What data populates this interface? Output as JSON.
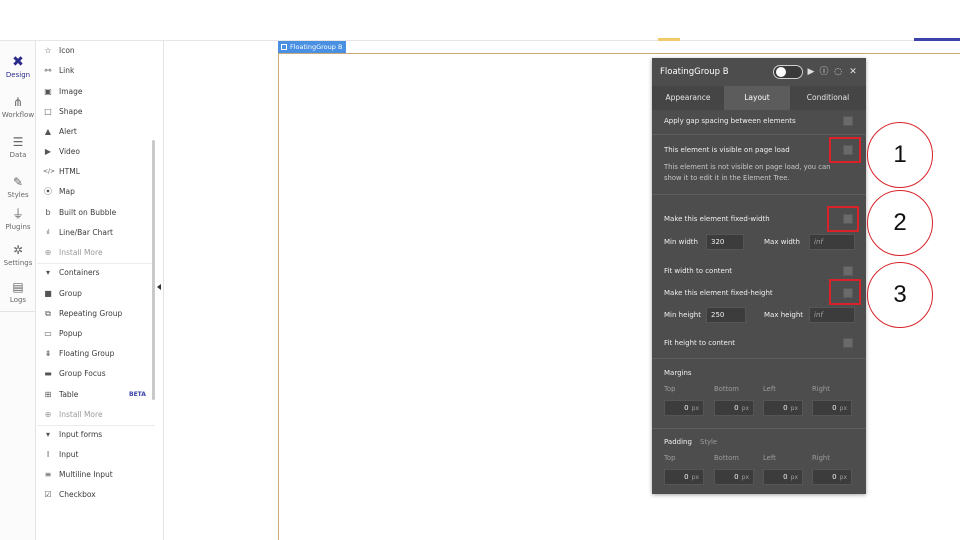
{
  "leftnav": {
    "items": [
      {
        "label": "Design",
        "icon": "design-icon"
      },
      {
        "label": "Workflow",
        "icon": "workflow-icon"
      },
      {
        "label": "Data",
        "icon": "data-icon"
      },
      {
        "label": "Styles",
        "icon": "styles-icon"
      },
      {
        "label": "Plugins",
        "icon": "plugins-icon"
      },
      {
        "label": "Settings",
        "icon": "settings-icon"
      },
      {
        "label": "Logs",
        "icon": "logs-icon"
      }
    ]
  },
  "palette": {
    "items": [
      {
        "label": "Icon",
        "icon": "star-icon",
        "glyph": "☆"
      },
      {
        "label": "Link",
        "icon": "link-icon",
        "glyph": "⚯"
      },
      {
        "label": "Image",
        "icon": "image-icon",
        "glyph": "▣"
      },
      {
        "label": "Shape",
        "icon": "shape-icon",
        "glyph": "□"
      },
      {
        "label": "Alert",
        "icon": "alert-icon",
        "glyph": "▲"
      },
      {
        "label": "Video",
        "icon": "video-icon",
        "glyph": "▶"
      },
      {
        "label": "HTML",
        "icon": "html-icon",
        "glyph": "</>"
      },
      {
        "label": "Map",
        "icon": "map-icon",
        "glyph": "⦿"
      },
      {
        "label": "Built on Bubble",
        "icon": "bubble-icon",
        "glyph": "b"
      },
      {
        "label": "Line/Bar Chart",
        "icon": "chart-icon",
        "glyph": "ıl"
      },
      {
        "label": "Install More",
        "icon": "plus-circle-icon",
        "glyph": "⊕"
      },
      {
        "label": "Containers",
        "icon": "caret-down-icon",
        "glyph": "▾"
      },
      {
        "label": "Group",
        "icon": "group-icon",
        "glyph": "■"
      },
      {
        "label": "Repeating Group",
        "icon": "repeating-group-icon",
        "glyph": "⧉"
      },
      {
        "label": "Popup",
        "icon": "popup-icon",
        "glyph": "▭"
      },
      {
        "label": "Floating Group",
        "icon": "floating-group-icon",
        "glyph": "⇟"
      },
      {
        "label": "Group Focus",
        "icon": "group-focus-icon",
        "glyph": "▬"
      },
      {
        "label": "Table",
        "icon": "table-icon",
        "glyph": "⊞",
        "badge": "BETA"
      },
      {
        "label": "Install More",
        "icon": "plus-circle-icon",
        "glyph": "⊕"
      },
      {
        "label": "Input forms",
        "icon": "caret-down-icon",
        "glyph": "▾"
      },
      {
        "label": "Input",
        "icon": "input-icon",
        "glyph": "I"
      },
      {
        "label": "Multiline Input",
        "icon": "multiline-icon",
        "glyph": "≡"
      },
      {
        "label": "Checkbox",
        "icon": "checkbox-icon",
        "glyph": "☑"
      }
    ]
  },
  "canvas": {
    "tag": "FloatingGroup B"
  },
  "panel": {
    "title": "FloatingGroup B",
    "tabs": [
      "Appearance",
      "Layout",
      "Conditional"
    ],
    "active_tab": "Layout",
    "gap_spacing_label": "Apply gap spacing between elements",
    "visible_on_load_label": "This element is visible on page load",
    "visible_on_load_note": "This element is not visible on page load, you can show it to edit it in the Element Tree.",
    "fixed_width_label": "Make this element fixed-width",
    "min_width_label": "Min width",
    "min_width_value": "320",
    "max_width_label": "Max width",
    "max_width_value": "inf",
    "fit_width_label": "Fit width to content",
    "fixed_height_label": "Make this element fixed-height",
    "min_height_label": "Min height",
    "min_height_value": "250",
    "max_height_label": "Max height",
    "max_height_value": "inf",
    "fit_height_label": "Fit height to content",
    "margins_label": "Margins",
    "padding_label": "Padding",
    "padding_style_label": "Style",
    "side_labels": [
      "Top",
      "Bottom",
      "Left",
      "Right"
    ],
    "margin_values": [
      "0",
      "0",
      "0",
      "0"
    ],
    "padding_values": [
      "0",
      "0",
      "0",
      "0"
    ],
    "unit": "px"
  },
  "annotations": [
    "1",
    "2",
    "3"
  ],
  "colors": {
    "annotation": "#d8232a",
    "panel_bg": "#4d4d4d",
    "accent": "#3b43a8"
  }
}
